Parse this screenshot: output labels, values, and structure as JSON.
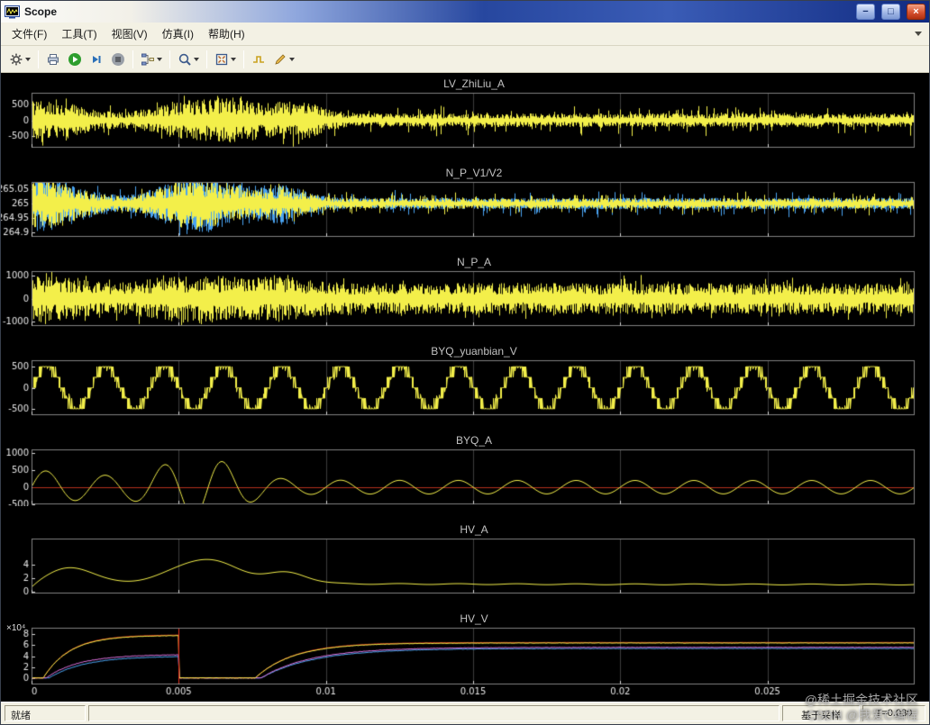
{
  "window": {
    "title": "Scope",
    "controls": {
      "minimize": "−",
      "maximize": "□",
      "close": "×"
    }
  },
  "menubar": {
    "items": [
      {
        "label": "文件(F)"
      },
      {
        "label": "工具(T)"
      },
      {
        "label": "视图(V)"
      },
      {
        "label": "仿真(I)"
      },
      {
        "label": "帮助(H)"
      }
    ]
  },
  "toolbar": {
    "buttons": [
      "scope-parameters",
      "print",
      "run",
      "step-forward",
      "stop",
      "signal-selector",
      "zoom",
      "fit-to-view",
      "trigger",
      "line-style"
    ]
  },
  "statusbar": {
    "ready": "就绪",
    "sample_mode": "基于采样",
    "time": "T=0.030"
  },
  "watermark": {
    "line1": "@稀土掘金技术社区",
    "line2": "CSDN @我爱C编程"
  },
  "xaxis": {
    "xlim": [
      0,
      0.03
    ],
    "ticks": [
      {
        "v": 0,
        "label": "0"
      },
      {
        "v": 0.005,
        "label": "0.005"
      },
      {
        "v": 0.01,
        "label": "0.01"
      },
      {
        "v": 0.015,
        "label": "0.015"
      },
      {
        "v": 0.02,
        "label": "0.02"
      },
      {
        "v": 0.025,
        "label": "0.025"
      }
    ]
  },
  "chart_data": [
    {
      "type": "line",
      "title": "LV_ZhiLiu_A",
      "ylim": [
        -850,
        850
      ],
      "yticks": [
        {
          "v": 500,
          "label": "500"
        },
        {
          "v": 0,
          "label": "0"
        },
        {
          "v": -500,
          "label": "-500"
        }
      ],
      "series": [
        {
          "gen": "burst_noise",
          "color": "#f3ef4a",
          "center": 0,
          "base_amp": 210,
          "spike_prob": 0.1,
          "spike_amp": 300,
          "seed": 11,
          "bursts": [
            [
              0.0003,
              430,
              0.0012
            ],
            [
              0.0056,
              440,
              0.0011
            ],
            [
              0.0069,
              230,
              0.0005
            ],
            [
              0.0084,
              320,
              0.0008
            ],
            [
              0.0094,
              210,
              0.0005
            ]
          ]
        }
      ]
    },
    {
      "type": "line",
      "title": "N_P_V1/V2",
      "ylim": [
        264.885,
        265.075
      ],
      "yticks": [
        {
          "v": 265.05,
          "label": "265.05"
        },
        {
          "v": 265,
          "label": "265"
        },
        {
          "v": 264.95,
          "label": "264.95"
        },
        {
          "v": 264.9,
          "label": "264.9"
        }
      ],
      "series": [
        {
          "gen": "burst_noise",
          "color": "#4aa3f0",
          "center": 265,
          "base_amp": 0.02,
          "spike_prob": 0.1,
          "spike_amp": 0.03,
          "seed": 21,
          "bursts": [
            [
              0.0003,
              0.075,
              0.0012
            ],
            [
              0.0056,
              0.08,
              0.0011
            ],
            [
              0.0084,
              0.045,
              0.0008
            ]
          ]
        },
        {
          "gen": "burst_noise",
          "color": "#f3ef4a",
          "center": 265,
          "base_amp": 0.018,
          "spike_prob": 0.1,
          "spike_amp": 0.025,
          "seed": 22,
          "bursts": [
            [
              0.0003,
              0.07,
              0.0012
            ],
            [
              0.0056,
              0.072,
              0.0011
            ],
            [
              0.0084,
              0.04,
              0.0008
            ]
          ]
        }
      ]
    },
    {
      "type": "line",
      "title": "N_P_A",
      "ylim": [
        -1200,
        1200
      ],
      "yticks": [
        {
          "v": 1000,
          "label": "1000"
        },
        {
          "v": 0,
          "label": "0"
        },
        {
          "v": -1000,
          "label": "-1000"
        }
      ],
      "series": [
        {
          "gen": "burst_noise",
          "color": "#f3ef4a",
          "center": 0,
          "base_amp": 680,
          "spike_prob": 0.07,
          "spike_amp": 380,
          "seed": 31,
          "bursts": [
            [
              0.0003,
              380,
              0.0012
            ],
            [
              0.0056,
              400,
              0.0012
            ],
            [
              0.0085,
              260,
              0.0009
            ]
          ]
        }
      ]
    },
    {
      "type": "line",
      "title": "BYQ_yuanbian_V",
      "ylim": [
        -650,
        650
      ],
      "yticks": [
        {
          "v": 500,
          "label": "500"
        },
        {
          "v": 0,
          "label": "0"
        },
        {
          "v": -500,
          "label": "-500"
        }
      ],
      "series": [
        {
          "gen": "staircase",
          "color": "#f3ef4a",
          "amp": 500,
          "freq": 500,
          "step": 250,
          "seed": 41
        }
      ]
    },
    {
      "type": "line",
      "title": "BYQ_A",
      "ylim": [
        -500,
        1100
      ],
      "yticks": [
        {
          "v": 1000,
          "label": "1000"
        },
        {
          "v": 500,
          "label": "500"
        },
        {
          "v": 0,
          "label": "0"
        },
        {
          "v": -500,
          "label": "-500"
        }
      ],
      "series": [
        {
          "gen": "hline",
          "y": 0,
          "color": "#b5301c"
        },
        {
          "gen": "decay_sine",
          "color": "#f3ef4a",
          "freq": 500,
          "base": 195,
          "init_amp": 330,
          "init_tau": 0.0028,
          "burst": [
            0.0057,
            640,
            0.0012
          ],
          "seed": 51
        }
      ]
    },
    {
      "type": "line",
      "title": "HV_A",
      "ylim": [
        -0.3,
        7.8
      ],
      "yticks": [
        {
          "v": 4,
          "label": "4"
        },
        {
          "v": 2,
          "label": "2"
        },
        {
          "v": 0,
          "label": "0"
        }
      ],
      "series": [
        {
          "gen": "bumps",
          "color": "#f3ef4a",
          "steady": 1.0,
          "steady_extra": 0.3,
          "steady_tau": 0.012,
          "rise_tau": 0.0004,
          "ripple_amp": 0.07,
          "ripple_freq": 500,
          "seed": 61,
          "bumps": [
            [
              0.0013,
              2.3,
              0.0008
            ],
            [
              0.0059,
              3.55,
              0.0011
            ],
            [
              0.0087,
              1.55,
              0.0007
            ]
          ]
        }
      ]
    },
    {
      "type": "line",
      "title": "HV_V",
      "exp_label": "×10⁴",
      "xlabels": true,
      "ylim": [
        -12000,
        92000
      ],
      "yticks": [
        {
          "v": 80000,
          "label": "8"
        },
        {
          "v": 60000,
          "label": "6"
        },
        {
          "v": 40000,
          "label": "4"
        },
        {
          "v": 20000,
          "label": "2"
        },
        {
          "v": 0,
          "label": "0"
        }
      ],
      "series": [
        {
          "gen": "charge",
          "color": "#4aa3f0",
          "drop": 0.005,
          "noise": 900,
          "seed": 71,
          "p1": [
            0.0006,
            0.0012,
            40000
          ],
          "p2": [
            0.0078,
            0.0018,
            54000
          ]
        },
        {
          "gen": "charge",
          "color": "#d96fd9",
          "drop": 0.005,
          "noise": 900,
          "seed": 72,
          "p1": [
            0.0005,
            0.0011,
            43000
          ],
          "p2": [
            0.0078,
            0.0017,
            56000
          ]
        },
        {
          "gen": "charge",
          "color": "#cf2a1b",
          "drop": 0.005,
          "noise": 400,
          "seed": 73,
          "p1": [
            0.0004,
            0.0009,
            79000
          ],
          "p2": [
            0.0076,
            0.0013,
            65000
          ]
        },
        {
          "gen": "charge",
          "color": "#f3ef4a",
          "drop": 0.005,
          "noise": 800,
          "seed": 74,
          "p1": [
            0.0004,
            0.0009,
            78000
          ],
          "p2": [
            0.0076,
            0.0013,
            64000
          ]
        },
        {
          "gen": "vline",
          "x": 0.005,
          "color": "#e03020"
        }
      ]
    }
  ]
}
